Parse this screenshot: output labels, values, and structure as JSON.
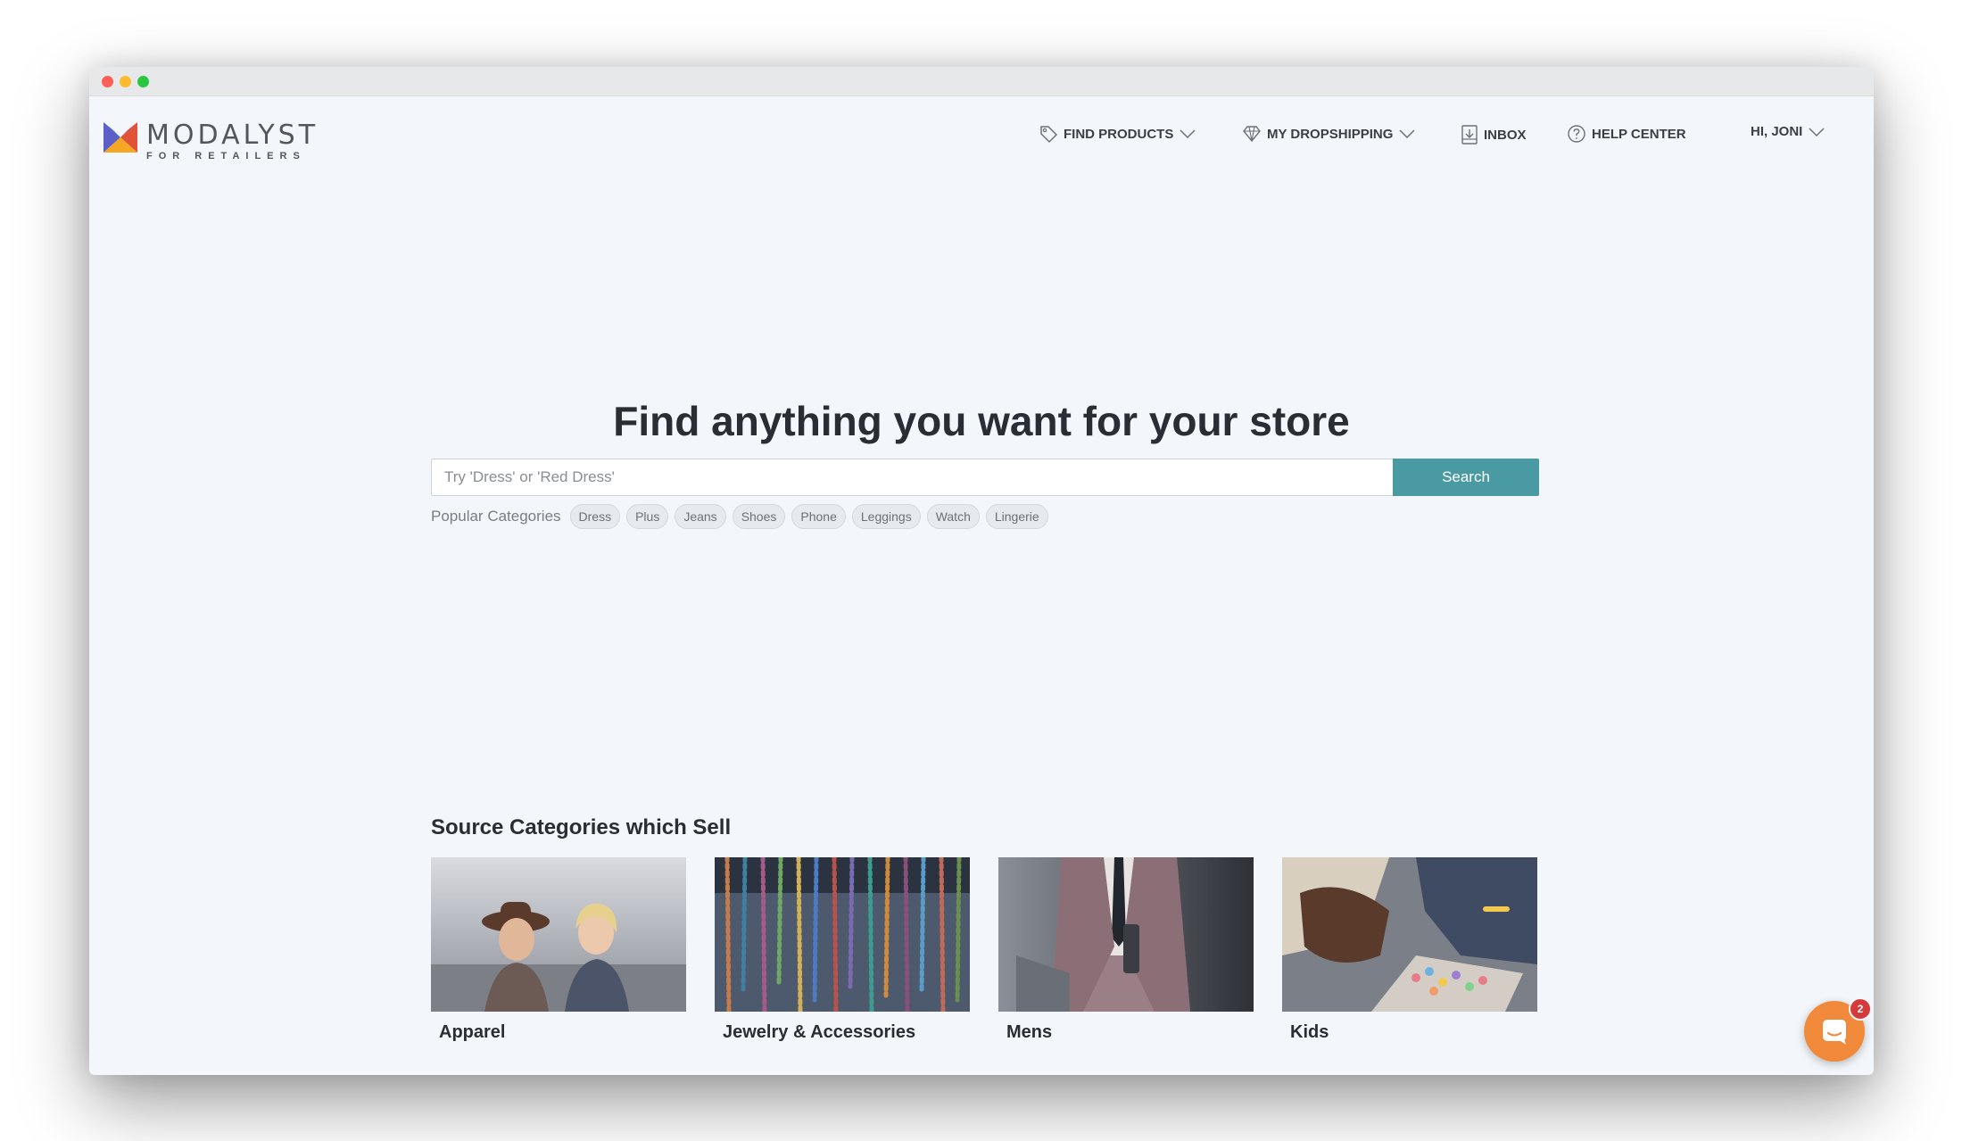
{
  "brand": {
    "name": "MODALYST",
    "tagline": "FOR RETAILERS",
    "logo_icon": "modalyst-logo-icon"
  },
  "nav": {
    "find_products": {
      "label": "FIND PRODUCTS",
      "icon": "tag-icon"
    },
    "my_dropshipping": {
      "label": "MY DROPSHIPPING",
      "icon": "diamond-icon"
    },
    "inbox": {
      "label": "INBOX",
      "icon": "inbox-icon"
    },
    "help_center": {
      "label": "HELP CENTER",
      "icon": "question-circle-icon"
    },
    "user_menu": {
      "label": "HI, JONI"
    }
  },
  "hero": {
    "title": "Find anything you want for your store",
    "search_placeholder": "Try 'Dress' or 'Red Dress'",
    "search_button": "Search",
    "popular_label": "Popular Categories",
    "popular_categories": [
      "Dress",
      "Plus",
      "Jeans",
      "Shoes",
      "Phone",
      "Leggings",
      "Watch",
      "Lingerie"
    ]
  },
  "source_section": {
    "title": "Source Categories which Sell",
    "cards": [
      {
        "label": "Apparel"
      },
      {
        "label": "Jewelry & Accessories"
      },
      {
        "label": "Mens"
      },
      {
        "label": "Kids"
      }
    ]
  },
  "chat": {
    "icon": "chat-icon",
    "badge_count": "2"
  },
  "colors": {
    "accent": "#4a9aa3",
    "page_background": "#f3f6fa",
    "chat_button": "#f08a3a",
    "badge": "#d53a3a"
  }
}
